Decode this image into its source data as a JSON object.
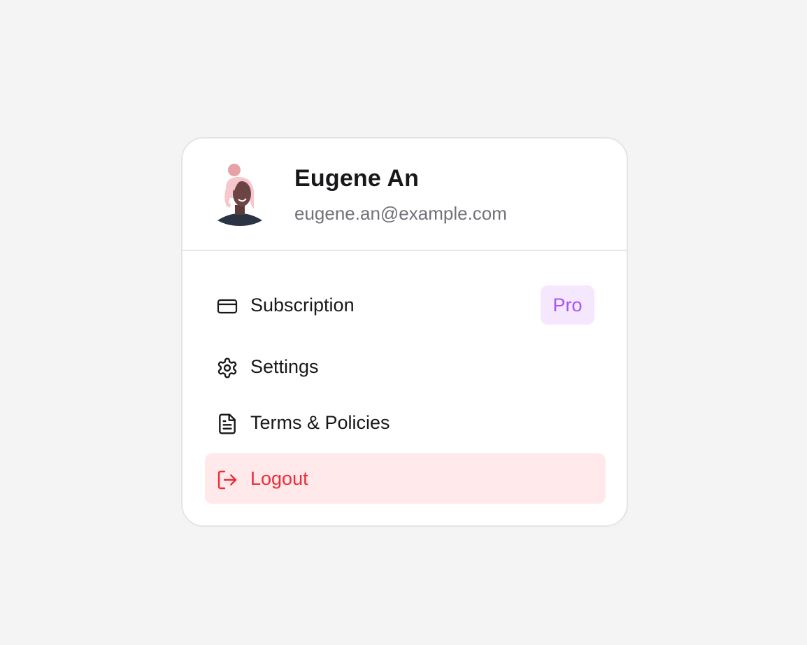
{
  "profile": {
    "name": "Eugene An",
    "email": "eugene.an@example.com"
  },
  "menu": {
    "items": [
      {
        "label": "Subscription",
        "icon": "credit-card-icon",
        "badge": "Pro"
      },
      {
        "label": "Settings",
        "icon": "gear-icon"
      },
      {
        "label": "Terms & Policies",
        "icon": "document-icon"
      },
      {
        "label": "Logout",
        "icon": "logout-icon"
      }
    ]
  },
  "colors": {
    "background": "#f4f4f4",
    "card": "#ffffff",
    "border": "#e4e4e7",
    "text": "#18181b",
    "muted": "#71717a",
    "badge_bg": "#f4e7fe",
    "badge_text": "#a855f7",
    "logout_bg": "#ffe9ea",
    "logout_text": "#ef2b34"
  }
}
